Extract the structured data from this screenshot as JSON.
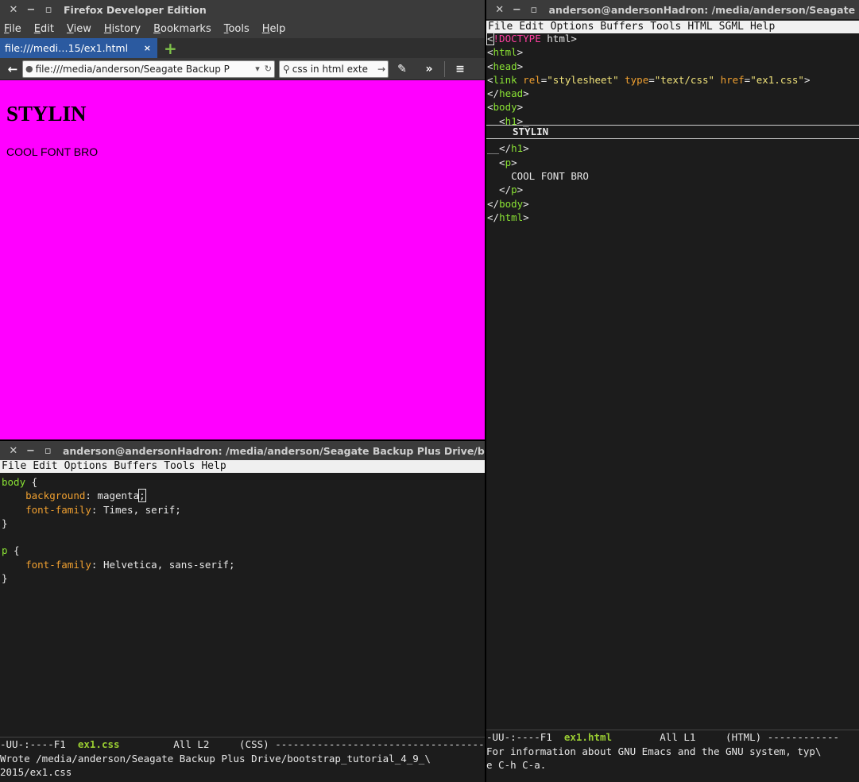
{
  "firefox": {
    "title": "Firefox Developer Edition",
    "menu": [
      "File",
      "Edit",
      "View",
      "History",
      "Bookmarks",
      "Tools",
      "Help"
    ],
    "tab_label": "file:///medi…15/ex1.html",
    "tab_close": "×",
    "new_tab": "+",
    "url": "file:///media/anderson/Seagate Backup P",
    "search": "css in html exte",
    "page": {
      "heading": "STYLIN",
      "paragraph": "COOL FONT BRO",
      "background": "#ff00ff"
    }
  },
  "emacs_css": {
    "title": "anderson@andersonHadron: /media/anderson/Seagate Backup Plus Drive/bo",
    "menu": [
      "File",
      "Edit",
      "Options",
      "Buffers",
      "Tools",
      "Help"
    ],
    "modeline_prefix": "-UU-:----F1  ",
    "buffer_name": "ex1.css",
    "modeline_suffix": "         All L2     (CSS) ---------------------------------------",
    "echo": "Wrote /media/anderson/Seagate Backup Plus Drive/bootstrap_tutorial_4_9_\\\n2015/ex1.css"
  },
  "emacs_html": {
    "title": "anderson@andersonHadron: /media/anderson/Seagate B",
    "menu": [
      "File",
      "Edit",
      "Options",
      "Buffers",
      "Tools",
      "HTML",
      "SGML",
      "Help"
    ],
    "modeline_prefix": "-UU-:----F1  ",
    "buffer_name": "ex1.html",
    "modeline_suffix": "        All L1     (HTML) ------------",
    "echo": "For information about GNU Emacs and the GNU system, typ\\\ne C-h C-a."
  }
}
